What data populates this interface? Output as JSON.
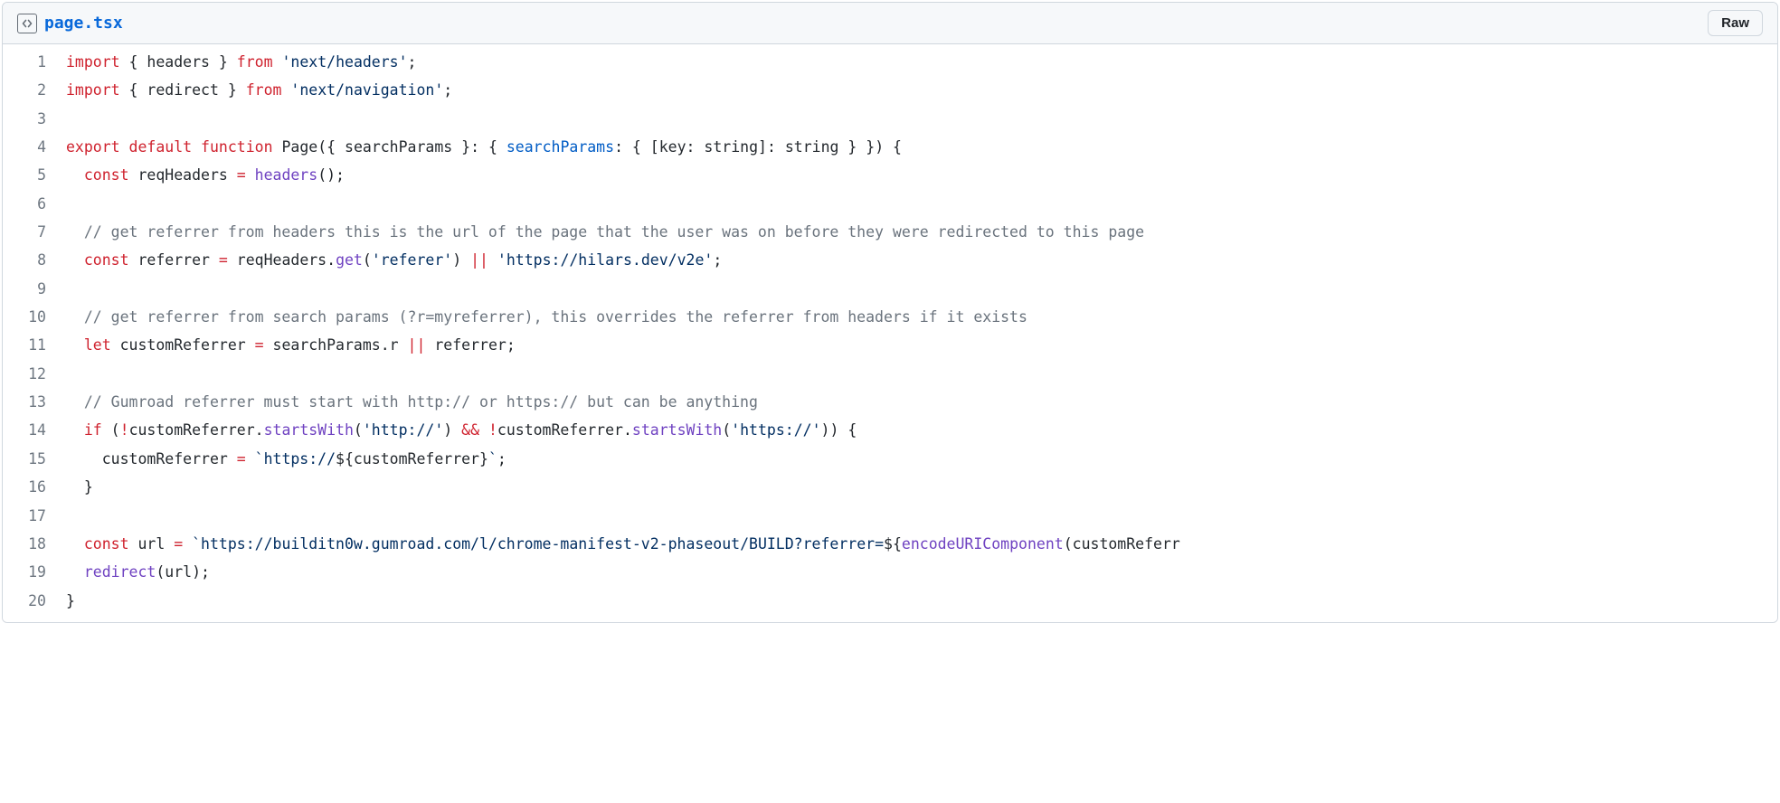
{
  "header": {
    "filename": "page.tsx",
    "raw_button_label": "Raw"
  },
  "code": {
    "lines": [
      {
        "num": 1,
        "tokens": [
          [
            "pl-k",
            "import"
          ],
          [
            "",
            " { "
          ],
          [
            "pl-smi",
            "headers"
          ],
          [
            "",
            " } "
          ],
          [
            "pl-k",
            "from"
          ],
          [
            "",
            " "
          ],
          [
            "pl-s",
            "'next/headers'"
          ],
          [
            "",
            ";"
          ]
        ]
      },
      {
        "num": 2,
        "tokens": [
          [
            "pl-k",
            "import"
          ],
          [
            "",
            " { "
          ],
          [
            "pl-smi",
            "redirect"
          ],
          [
            "",
            " } "
          ],
          [
            "pl-k",
            "from"
          ],
          [
            "",
            " "
          ],
          [
            "pl-s",
            "'next/navigation'"
          ],
          [
            "",
            ";"
          ]
        ]
      },
      {
        "num": 3,
        "tokens": [
          [
            "",
            ""
          ]
        ]
      },
      {
        "num": 4,
        "tokens": [
          [
            "pl-k",
            "export"
          ],
          [
            "",
            " "
          ],
          [
            "pl-k",
            "default"
          ],
          [
            "",
            " "
          ],
          [
            "pl-k",
            "function"
          ],
          [
            "",
            " "
          ],
          [
            "pl-smi",
            "Page"
          ],
          [
            "",
            "({ "
          ],
          [
            "pl-smi",
            "searchParams"
          ],
          [
            "",
            " }: { "
          ],
          [
            "pl-c1",
            "searchParams"
          ],
          [
            "",
            ": { ["
          ],
          [
            "pl-smi",
            "key"
          ],
          [
            "",
            ": "
          ],
          [
            "pl-smi",
            "string"
          ],
          [
            "",
            "]: "
          ],
          [
            "pl-smi",
            "string"
          ],
          [
            "",
            " } }) {"
          ]
        ]
      },
      {
        "num": 5,
        "tokens": [
          [
            "",
            "  "
          ],
          [
            "pl-k",
            "const"
          ],
          [
            "",
            " "
          ],
          [
            "pl-smi",
            "reqHeaders"
          ],
          [
            "",
            " "
          ],
          [
            "pl-k",
            "="
          ],
          [
            "",
            " "
          ],
          [
            "pl-en",
            "headers"
          ],
          [
            "",
            "();"
          ]
        ]
      },
      {
        "num": 6,
        "tokens": [
          [
            "",
            ""
          ]
        ]
      },
      {
        "num": 7,
        "tokens": [
          [
            "",
            "  "
          ],
          [
            "pl-c",
            "// get referrer from headers this is the url of the page that the user was on before they were redirected to this page"
          ]
        ]
      },
      {
        "num": 8,
        "tokens": [
          [
            "",
            "  "
          ],
          [
            "pl-k",
            "const"
          ],
          [
            "",
            " "
          ],
          [
            "pl-smi",
            "referrer"
          ],
          [
            "",
            " "
          ],
          [
            "pl-k",
            "="
          ],
          [
            "",
            " "
          ],
          [
            "pl-smi",
            "reqHeaders"
          ],
          [
            "",
            "."
          ],
          [
            "pl-en",
            "get"
          ],
          [
            "",
            "("
          ],
          [
            "pl-s",
            "'referer'"
          ],
          [
            "",
            ") "
          ],
          [
            "pl-k",
            "||"
          ],
          [
            "",
            " "
          ],
          [
            "pl-s",
            "'https://hilars.dev/v2e'"
          ],
          [
            "",
            ";"
          ]
        ]
      },
      {
        "num": 9,
        "tokens": [
          [
            "",
            ""
          ]
        ]
      },
      {
        "num": 10,
        "tokens": [
          [
            "",
            "  "
          ],
          [
            "pl-c",
            "// get referrer from search params (?r=myreferrer), this overrides the referrer from headers if it exists"
          ]
        ]
      },
      {
        "num": 11,
        "tokens": [
          [
            "",
            "  "
          ],
          [
            "pl-k",
            "let"
          ],
          [
            "",
            " "
          ],
          [
            "pl-smi",
            "customReferrer"
          ],
          [
            "",
            " "
          ],
          [
            "pl-k",
            "="
          ],
          [
            "",
            " "
          ],
          [
            "pl-smi",
            "searchParams"
          ],
          [
            "",
            "."
          ],
          [
            "pl-smi",
            "r"
          ],
          [
            "",
            " "
          ],
          [
            "pl-k",
            "||"
          ],
          [
            "",
            " "
          ],
          [
            "pl-smi",
            "referrer"
          ],
          [
            "",
            ";"
          ]
        ]
      },
      {
        "num": 12,
        "tokens": [
          [
            "",
            ""
          ]
        ]
      },
      {
        "num": 13,
        "tokens": [
          [
            "",
            "  "
          ],
          [
            "pl-c",
            "// Gumroad referrer must start with http:// or https:// but can be anything"
          ]
        ]
      },
      {
        "num": 14,
        "tokens": [
          [
            "",
            "  "
          ],
          [
            "pl-k",
            "if"
          ],
          [
            "",
            " ("
          ],
          [
            "pl-k",
            "!"
          ],
          [
            "pl-smi",
            "customReferrer"
          ],
          [
            "",
            "."
          ],
          [
            "pl-en",
            "startsWith"
          ],
          [
            "",
            "("
          ],
          [
            "pl-s",
            "'http://'"
          ],
          [
            "",
            ") "
          ],
          [
            "pl-k",
            "&&"
          ],
          [
            "",
            " "
          ],
          [
            "pl-k",
            "!"
          ],
          [
            "pl-smi",
            "customReferrer"
          ],
          [
            "",
            "."
          ],
          [
            "pl-en",
            "startsWith"
          ],
          [
            "",
            "("
          ],
          [
            "pl-s",
            "'https://'"
          ],
          [
            "",
            ")) {"
          ]
        ]
      },
      {
        "num": 15,
        "tokens": [
          [
            "",
            "    "
          ],
          [
            "pl-smi",
            "customReferrer"
          ],
          [
            "",
            " "
          ],
          [
            "pl-k",
            "="
          ],
          [
            "",
            " "
          ],
          [
            "pl-s",
            "`https://"
          ],
          [
            "",
            "${"
          ],
          [
            "pl-smi",
            "customReferrer"
          ],
          [
            "",
            "}"
          ],
          [
            "pl-s",
            "`"
          ],
          [
            "",
            ";"
          ]
        ]
      },
      {
        "num": 16,
        "tokens": [
          [
            "",
            "  }"
          ]
        ]
      },
      {
        "num": 17,
        "tokens": [
          [
            "",
            ""
          ]
        ]
      },
      {
        "num": 18,
        "tokens": [
          [
            "",
            "  "
          ],
          [
            "pl-k",
            "const"
          ],
          [
            "",
            " "
          ],
          [
            "pl-smi",
            "url"
          ],
          [
            "",
            " "
          ],
          [
            "pl-k",
            "="
          ],
          [
            "",
            " "
          ],
          [
            "pl-s",
            "`https://builditn0w.gumroad.com/l/chrome-manifest-v2-phaseout/BUILD?referrer="
          ],
          [
            "",
            "${"
          ],
          [
            "pl-en",
            "encodeURIComponent"
          ],
          [
            "",
            "("
          ],
          [
            "pl-smi",
            "customReferr"
          ]
        ]
      },
      {
        "num": 19,
        "tokens": [
          [
            "",
            "  "
          ],
          [
            "pl-en",
            "redirect"
          ],
          [
            "",
            "("
          ],
          [
            "pl-smi",
            "url"
          ],
          [
            "",
            ");"
          ]
        ]
      },
      {
        "num": 20,
        "tokens": [
          [
            "",
            "}"
          ]
        ]
      }
    ]
  }
}
